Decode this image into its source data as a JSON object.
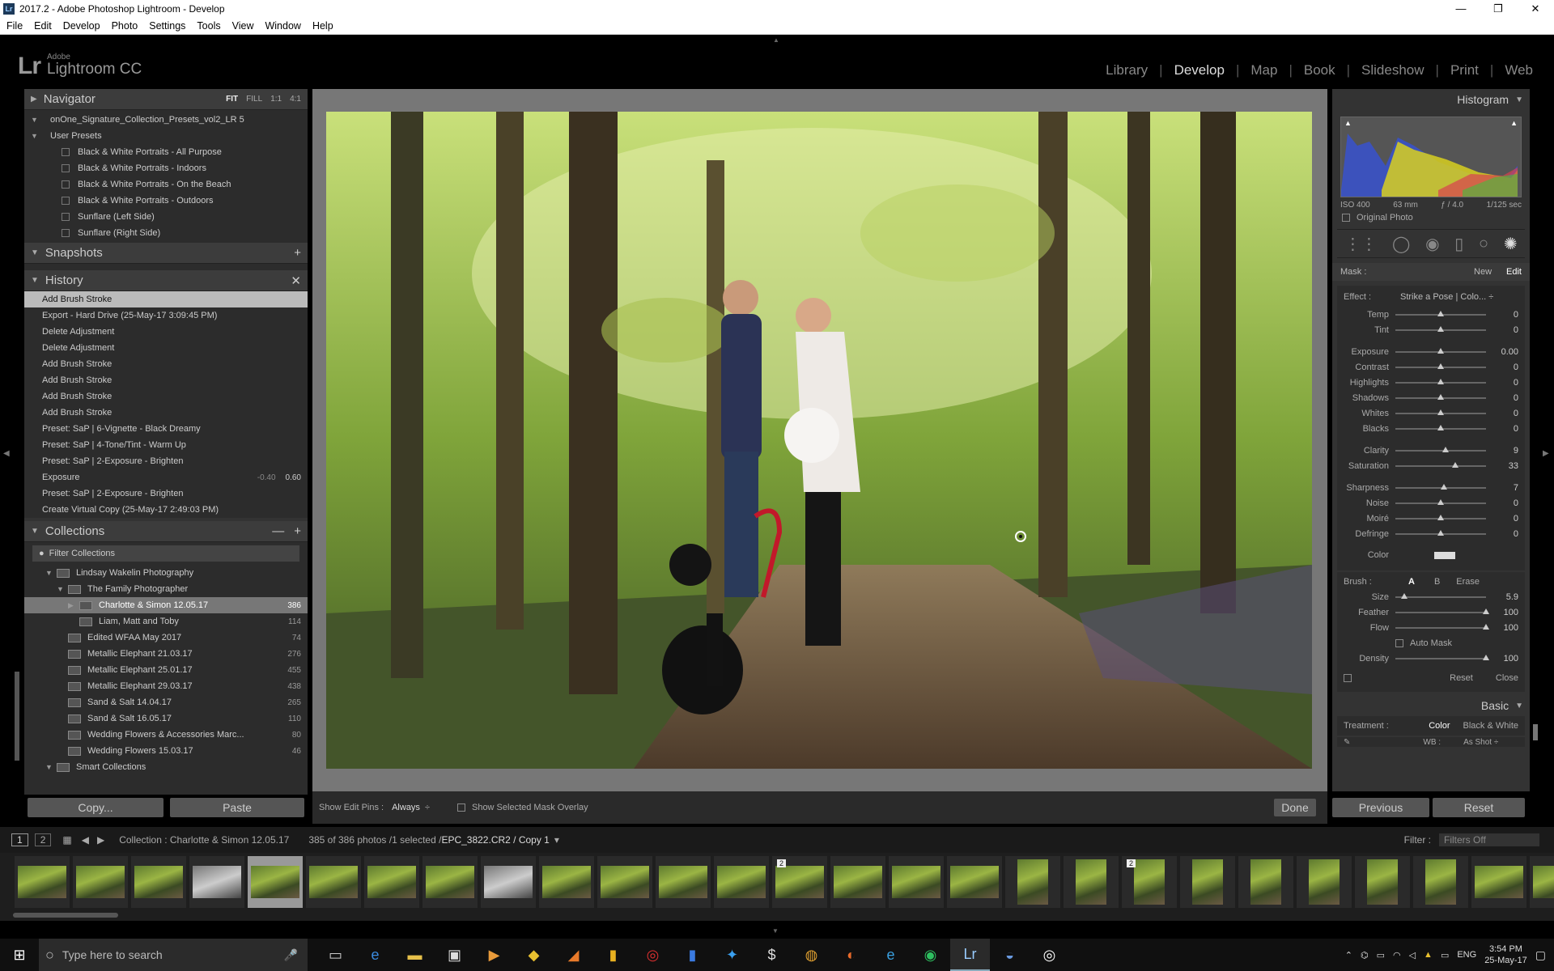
{
  "window": {
    "title": "2017.2 - Adobe Photoshop Lightroom - Develop",
    "controls": [
      "—",
      "❐",
      "✕"
    ]
  },
  "menu": [
    "File",
    "Edit",
    "Develop",
    "Photo",
    "Settings",
    "Tools",
    "View",
    "Window",
    "Help"
  ],
  "identity": {
    "logo": "Lr",
    "adobe": "Adobe",
    "product": "Lightroom CC"
  },
  "modules": {
    "active": "Develop",
    "items": [
      "Library",
      "Develop",
      "Map",
      "Book",
      "Slideshow",
      "Print",
      "Web"
    ]
  },
  "navigator": {
    "title": "Navigator",
    "options": [
      "FIT",
      "FILL",
      "1:1",
      "4:1"
    ]
  },
  "presets": {
    "group": "onOne_Signature_Collection_Presets_vol2_LR 5",
    "user_group": "User Presets",
    "items": [
      "Black & White Portraits - All Purpose",
      "Black & White Portraits - Indoors",
      "Black & White Portraits - On the Beach",
      "Black & White Portraits - Outdoors",
      "Sunflare (Left Side)",
      "Sunflare (Right Side)"
    ]
  },
  "snapshots": {
    "title": "Snapshots"
  },
  "history": {
    "title": "History",
    "items": [
      {
        "label": "Add Brush Stroke",
        "selected": true
      },
      {
        "label": "Export - Hard Drive (25-May-17 3:09:45 PM)"
      },
      {
        "label": "Delete Adjustment"
      },
      {
        "label": "Delete Adjustment"
      },
      {
        "label": "Add Brush Stroke"
      },
      {
        "label": "Add Brush Stroke"
      },
      {
        "label": "Add Brush Stroke"
      },
      {
        "label": "Add Brush Stroke"
      },
      {
        "label": "Preset: SaP | 6-Vignette - Black Dreamy"
      },
      {
        "label": "Preset: SaP | 4-Tone/Tint - Warm Up"
      },
      {
        "label": "Preset: SaP | 2-Exposure - Brighten"
      },
      {
        "label": "Exposure",
        "v1": "-0.40",
        "v2": "0.60"
      },
      {
        "label": "Preset: SaP | 2-Exposure - Brighten"
      },
      {
        "label": "Create Virtual Copy (25-May-17 2:49:03 PM)"
      }
    ]
  },
  "collections": {
    "title": "Collections",
    "filter": "Filter Collections",
    "items": [
      {
        "label": "Lindsay Wakelin Photography",
        "indent": 1
      },
      {
        "label": "The Family Photographer",
        "indent": 2
      },
      {
        "label": "Charlotte & Simon 12.05.17",
        "count": "386",
        "indent": 3,
        "selected": true
      },
      {
        "label": "Liam, Matt and Toby",
        "count": "114",
        "indent": 3
      },
      {
        "label": "Edited WFAA May 2017",
        "count": "74",
        "indent": 2
      },
      {
        "label": "Metallic Elephant 21.03.17",
        "count": "276",
        "indent": 2
      },
      {
        "label": "Metallic Elephant 25.01.17",
        "count": "455",
        "indent": 2
      },
      {
        "label": "Metallic Elephant 29.03.17",
        "count": "438",
        "indent": 2
      },
      {
        "label": "Sand & Salt 14.04.17",
        "count": "265",
        "indent": 2
      },
      {
        "label": "Sand & Salt 16.05.17",
        "count": "110",
        "indent": 2
      },
      {
        "label": "Wedding Flowers & Accessories Marc...",
        "count": "80",
        "indent": 2
      },
      {
        "label": "Wedding Flowers 15.03.17",
        "count": "46",
        "indent": 2
      },
      {
        "label": "Smart Collections",
        "indent": 1
      }
    ]
  },
  "left_buttons": {
    "copy": "Copy...",
    "paste": "Paste"
  },
  "toolbar": {
    "pins_label": "Show Edit Pins :",
    "pins_value": "Always",
    "overlay": "Show Selected Mask Overlay",
    "done": "Done"
  },
  "histogram": {
    "title": "Histogram",
    "iso": "ISO 400",
    "focal": "63 mm",
    "aperture": "ƒ / 4.0",
    "shutter": "1/125 sec",
    "original": "Original Photo"
  },
  "mask": {
    "label": "Mask :",
    "new": "New",
    "edit": "Edit"
  },
  "effect": {
    "label": "Effect :",
    "value": "Strike a Pose | Colo... ÷"
  },
  "sliders": [
    {
      "label": "Temp",
      "value": "0",
      "pos": 0.5
    },
    {
      "label": "Tint",
      "value": "0",
      "pos": 0.5
    },
    {
      "gap": true
    },
    {
      "label": "Exposure",
      "value": "0.00",
      "pos": 0.5
    },
    {
      "label": "Contrast",
      "value": "0",
      "pos": 0.5
    },
    {
      "label": "Highlights",
      "value": "0",
      "pos": 0.5
    },
    {
      "label": "Shadows",
      "value": "0",
      "pos": 0.5
    },
    {
      "label": "Whites",
      "value": "0",
      "pos": 0.5
    },
    {
      "label": "Blacks",
      "value": "0",
      "pos": 0.5
    },
    {
      "gap": true
    },
    {
      "label": "Clarity",
      "value": "9",
      "pos": 0.55
    },
    {
      "label": "Saturation",
      "value": "33",
      "pos": 0.66
    },
    {
      "gap": true
    },
    {
      "label": "Sharpness",
      "value": "7",
      "pos": 0.54
    },
    {
      "label": "Noise",
      "value": "0",
      "pos": 0.5
    },
    {
      "label": "Moiré",
      "value": "0",
      "pos": 0.5
    },
    {
      "label": "Defringe",
      "value": "0",
      "pos": 0.5
    }
  ],
  "color_label": "Color",
  "brush": {
    "label": "Brush :",
    "a": "A",
    "b": "B",
    "erase": "Erase",
    "sliders": [
      {
        "label": "Size",
        "value": "5.9",
        "pos": 0.1
      },
      {
        "label": "Feather",
        "value": "100",
        "pos": 1.0
      },
      {
        "label": "Flow",
        "value": "100",
        "pos": 1.0
      }
    ],
    "automask": "Auto Mask",
    "density": {
      "label": "Density",
      "value": "100",
      "pos": 1.0
    },
    "reset": "Reset",
    "close": "Close"
  },
  "basic": {
    "title": "Basic",
    "treatment": "Treatment :",
    "color": "Color",
    "bw": "Black & White",
    "wb": "WB :",
    "wb_value": "As Shot ÷"
  },
  "right_buttons": {
    "previous": "Previous",
    "reset": "Reset"
  },
  "filmbar": {
    "page1": "1",
    "page2": "2",
    "collection": "Collection : Charlotte & Simon 12.05.17",
    "count": "385 of 386 photos /1 selected /",
    "file": "EPC_3822.CR2 / Copy 1",
    "filter_label": "Filter :",
    "filter_value": "Filters Off"
  },
  "filmstrip_badges": [
    "2",
    "2"
  ],
  "taskbar": {
    "search": "Type here to search",
    "lang": "ENG",
    "time": "3:54 PM",
    "date": "25-May-17"
  }
}
